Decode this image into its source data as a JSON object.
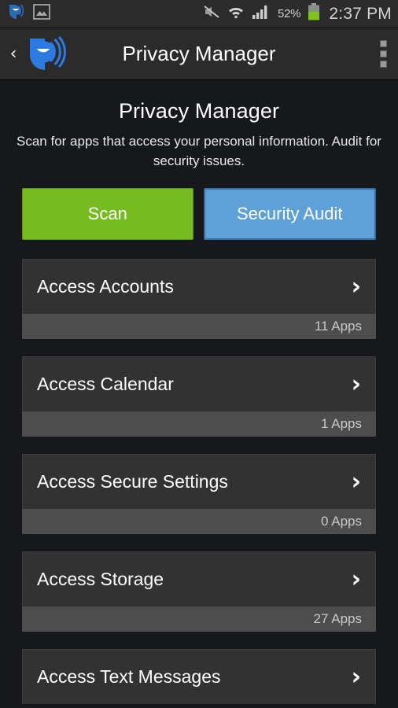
{
  "statusbar": {
    "left_icons": [
      {
        "name": "app-notification-icon",
        "label": "Privacy Manager notification"
      },
      {
        "name": "screenshot-icon",
        "label": "Screenshot captured"
      }
    ],
    "right_icons": [
      {
        "name": "mute-icon",
        "label": "Sound off"
      },
      {
        "name": "wifi-icon",
        "label": "Wi-Fi connected"
      },
      {
        "name": "cellular-signal-icon",
        "label": "Signal full"
      }
    ],
    "battery_percent": "52%",
    "battery_icon": "battery-icon",
    "time": "2:37 PM"
  },
  "actionbar": {
    "back_icon": "‹",
    "app_logo": "app-logo-icon",
    "title": "Privacy Manager",
    "overflow_icon": "overflow-menu-icon"
  },
  "page": {
    "title": "Privacy Manager",
    "subtitle": "Scan for apps that access your personal information. Audit for security issues."
  },
  "buttons": {
    "scan_label": "Scan",
    "audit_label": "Security Audit",
    "scan_color": "#76bc21",
    "audit_color": "#5ea0d8"
  },
  "permission_groups": [
    {
      "label": "Access Accounts",
      "count": "11 Apps",
      "chevron": "›"
    },
    {
      "label": "Access Calendar",
      "count": "1 Apps",
      "chevron": "›"
    },
    {
      "label": "Access Secure Settings",
      "count": "0 Apps",
      "chevron": "›"
    },
    {
      "label": "Access Storage",
      "count": "27 Apps",
      "chevron": "›"
    },
    {
      "label": "Access Text Messages",
      "count": "",
      "chevron": "›"
    }
  ]
}
